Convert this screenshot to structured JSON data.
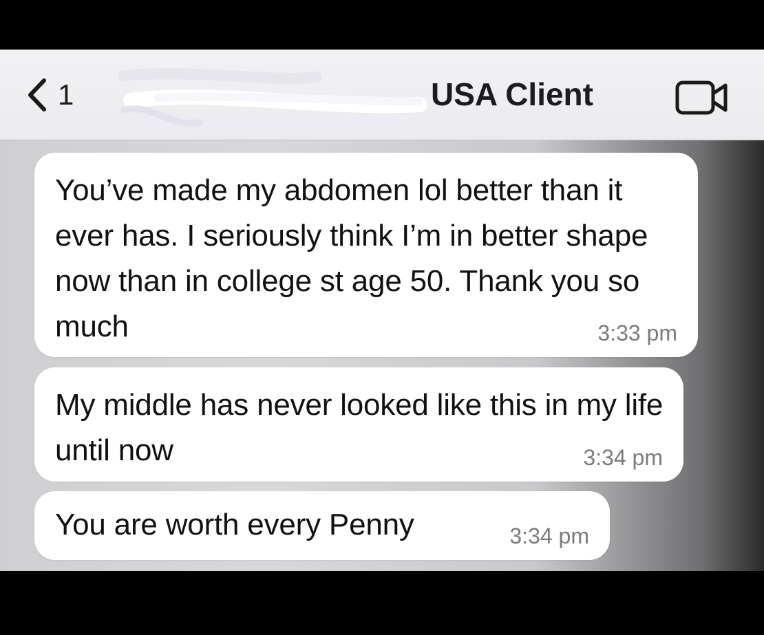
{
  "header": {
    "back_count": "1",
    "contact_name": "USA Client"
  },
  "icons": {
    "back": "chevron-left-icon",
    "video": "video-camera-icon"
  },
  "messages": [
    {
      "text": "You’ve made my abdomen lol better than it ever has.  I seriously think I’m in better shape now than in college st age 50.  Thank you so much",
      "time": "3:33 pm"
    },
    {
      "text": "My middle has never looked like this in my life until now",
      "time": "3:34 pm"
    },
    {
      "text": "You are worth every Penny",
      "time": "3:34 pm"
    }
  ],
  "colors": {
    "bubble": "#ffffff",
    "header": "#f2f2f4",
    "timestamp": "#7b7b7e"
  }
}
